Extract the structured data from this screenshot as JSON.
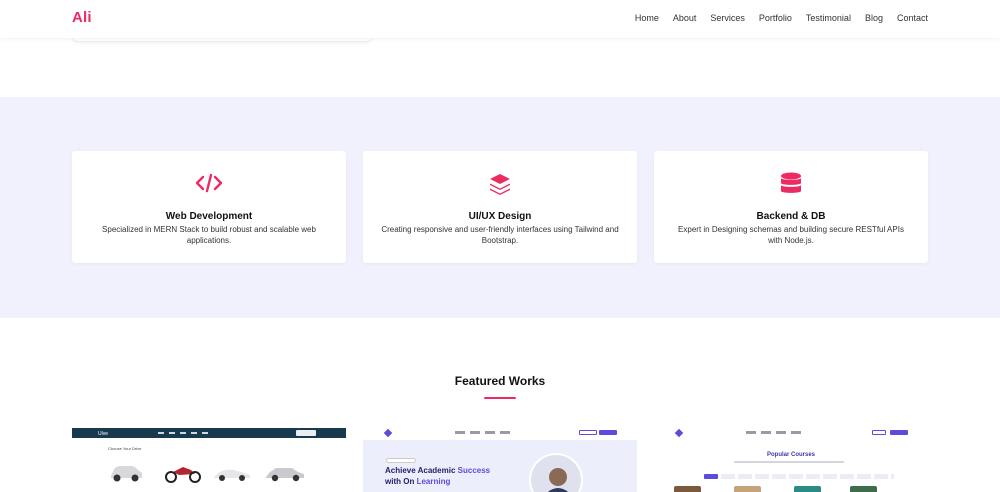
{
  "header": {
    "logo": "Ali",
    "nav": [
      "Home",
      "About",
      "Services",
      "Portfolio",
      "Testimonial",
      "Blog",
      "Contact"
    ]
  },
  "services": [
    {
      "icon": "code-icon",
      "title": "Web Development",
      "desc": "Specialized in MERN Stack to build robust and scalable web applications."
    },
    {
      "icon": "layers-icon",
      "title": "UI/UX Design",
      "desc": "Creating responsive and user-friendly interfaces using Tailwind and Bootstrap."
    },
    {
      "icon": "database-icon",
      "title": "Backend & DB",
      "desc": "Expert in Designing schemas and building secure RESTful APIs with Node.js."
    }
  ],
  "featured": {
    "title": "Featured Works",
    "works": [
      {
        "logo": "Ulve",
        "subtitle": "Choose Your Drive"
      },
      {
        "headline_a": "Achieve Academic ",
        "headline_b": "Success",
        "headline_c": "with On ",
        "headline_d": "Learning"
      },
      {
        "heading": "Popular Courses"
      }
    ]
  },
  "colors": {
    "accent": "#ee2a63",
    "section_bg": "#f1f1fd",
    "brand_purple": "#5b4cdb"
  }
}
